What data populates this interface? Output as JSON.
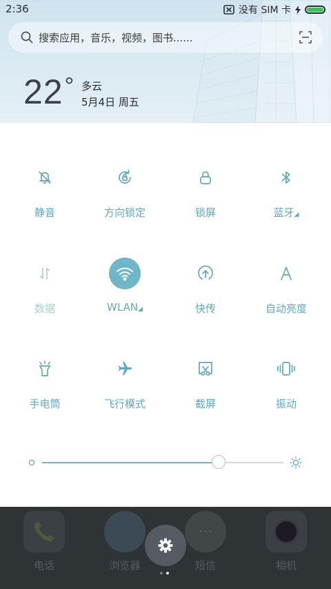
{
  "status_bar": {
    "time": "2:36",
    "sim_text": "没有 SIM 卡",
    "battery": "full"
  },
  "search": {
    "placeholder": "搜索应用，音乐，视频，图书......",
    "icon": "search-icon",
    "scan_icon": "scan-icon"
  },
  "weather": {
    "temperature": "22",
    "degree": "°",
    "condition": "多云",
    "date": "5月4日 周五"
  },
  "quick_settings": {
    "items": [
      {
        "label": "静音",
        "icon": "bell-off-icon",
        "active": false,
        "dim": false
      },
      {
        "label": "方向锁定",
        "icon": "rotation-lock-icon",
        "active": false,
        "dim": false
      },
      {
        "label": "锁屏",
        "icon": "lock-icon",
        "active": false,
        "dim": false
      },
      {
        "label": "蓝牙",
        "icon": "bluetooth-icon",
        "active": false,
        "dim": false,
        "expandable": true
      },
      {
        "label": "数据",
        "icon": "mobile-data-icon",
        "active": false,
        "dim": true
      },
      {
        "label": "WLAN",
        "icon": "wifi-icon",
        "active": true,
        "dim": false,
        "expandable": true
      },
      {
        "label": "快传",
        "icon": "quick-transfer-icon",
        "active": false,
        "dim": false
      },
      {
        "label": "自动亮度",
        "icon": "auto-brightness-icon",
        "active": false,
        "dim": false
      },
      {
        "label": "手电筒",
        "icon": "flashlight-icon",
        "active": false,
        "dim": false
      },
      {
        "label": "飞行模式",
        "icon": "airplane-icon",
        "active": false,
        "dim": false
      },
      {
        "label": "截屏",
        "icon": "screenshot-icon",
        "active": false,
        "dim": false
      },
      {
        "label": "振动",
        "icon": "vibrate-icon",
        "active": false,
        "dim": false
      }
    ]
  },
  "brightness": {
    "level": 0.73,
    "accent": "#6fb6c8"
  },
  "dock": {
    "apps": [
      {
        "label": "电话",
        "icon": "phone-icon"
      },
      {
        "label": "浏览器",
        "icon": "browser-icon"
      },
      {
        "label": "短信",
        "icon": "messages-icon"
      },
      {
        "label": "相机",
        "icon": "camera-icon"
      }
    ]
  },
  "page_indicator": {
    "count": 2,
    "current": 1
  },
  "colors": {
    "accent": "#6fb6c8",
    "label": "#5fa8bd",
    "dim_label": "#a9cfdb",
    "battery": "#38c35a"
  }
}
